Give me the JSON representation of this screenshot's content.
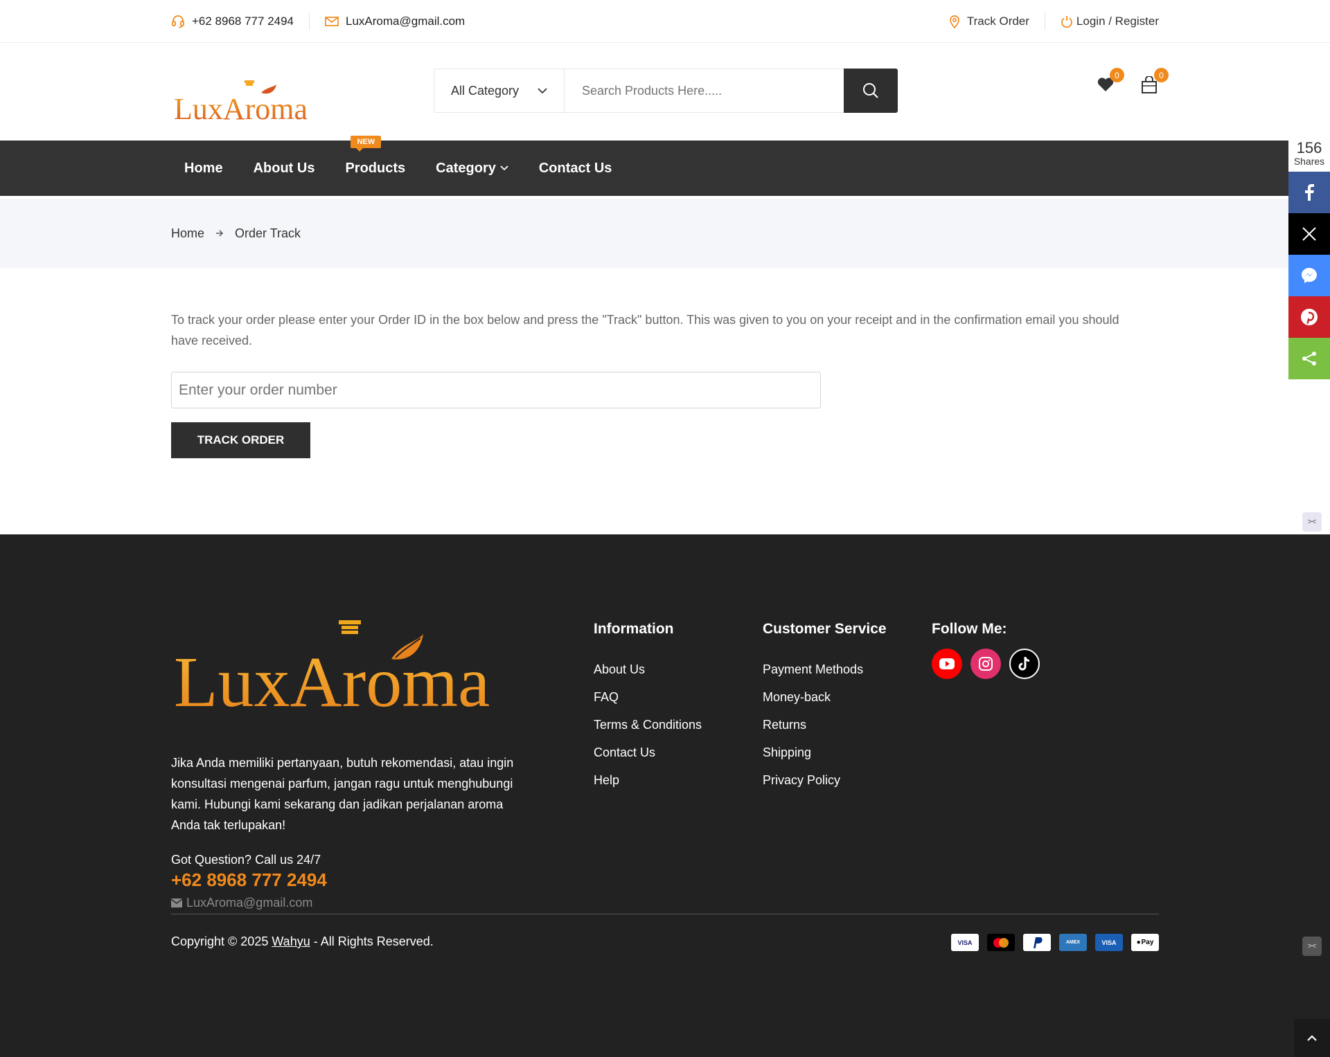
{
  "topbar": {
    "phone": "+62 8968 777 2494",
    "email": "LuxAroma@gmail.com",
    "track_order": "Track Order",
    "login_register": "Login / Register"
  },
  "header": {
    "logo_text": "LuxAroma",
    "category_select": "All Category",
    "search_placeholder": "Search Products Here.....",
    "wishlist_count": "0",
    "cart_count": "0"
  },
  "nav": {
    "items": [
      "Home",
      "About Us",
      "Products",
      "Category",
      "Contact Us"
    ],
    "new_badge": "NEW"
  },
  "breadcrumb": {
    "home": "Home",
    "current": "Order Track"
  },
  "main": {
    "description": "To track your order please enter your Order ID in the box below and press the \"Track\" button. This was given to you on your receipt and in the confirmation email you should have received.",
    "order_placeholder": "Enter your order number",
    "track_button": "TRACK ORDER"
  },
  "share": {
    "count": "156",
    "label": "Shares",
    "buttons": [
      "facebook-icon",
      "x-icon",
      "messenger-icon",
      "pinterest-icon",
      "share-icon"
    ]
  },
  "footer": {
    "logo_text": "LuxAroma",
    "description": "Jika Anda memiliki pertanyaan, butuh rekomendasi, atau ingin konsultasi mengenai parfum, jangan ragu untuk menghubungi kami. Hubungi kami sekarang dan jadikan perjalanan aroma Anda tak terlupakan!",
    "question": "Got Question? Call us 24/7",
    "phone": "+62 8968 777 2494",
    "email": "LuxAroma@gmail.com",
    "information": {
      "title": "Information",
      "links": [
        "About Us",
        "FAQ",
        "Terms & Conditions",
        "Contact Us",
        "Help"
      ]
    },
    "customer_service": {
      "title": "Customer Service",
      "links": [
        "Payment Methods",
        "Money-back",
        "Returns",
        "Shipping",
        "Privacy Policy"
      ]
    },
    "follow": {
      "title": "Follow Me:",
      "icons": [
        "youtube-icon",
        "instagram-icon",
        "tiktok-icon"
      ]
    },
    "copyright_prefix": "Copyright © 2025 ",
    "copyright_author": "Wahyu",
    "copyright_suffix": " - All Rights Reserved.",
    "payments": [
      "VISA",
      "Mastercard",
      "PayPal",
      "AMEX",
      "VISA",
      "Pay"
    ]
  },
  "colors": {
    "accent": "#f08a1c",
    "dark": "#333333",
    "footer_bg": "#222222"
  }
}
